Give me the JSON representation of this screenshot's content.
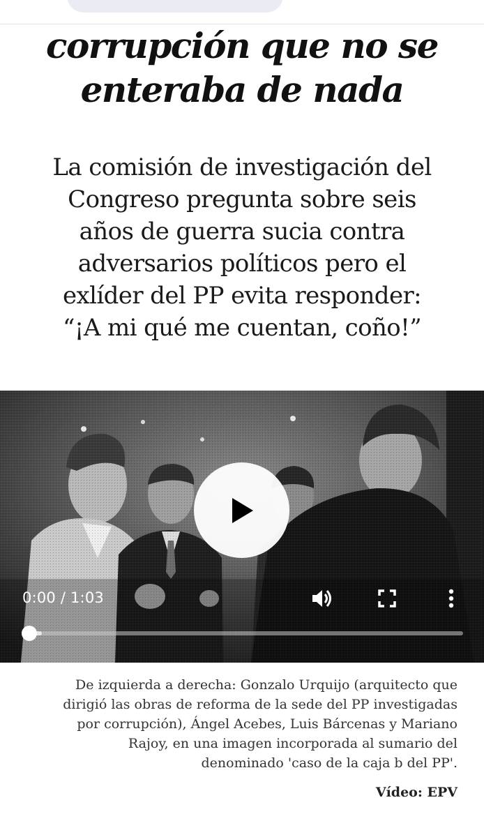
{
  "article": {
    "headline": "corrupción que no se\nenteraba de nada",
    "subtitle": "La comisión de investigación del\nCongreso pregunta sobre seis\naños de guerra sucia contra\nadversarios políticos pero el\nexlíder del PP evita responder:\n“¡A mi qué me cuentan, coño!”"
  },
  "video": {
    "current_time": "0:00",
    "duration": "1:03",
    "time_separator": " / ",
    "progress_fraction": 0.0,
    "icons": {
      "play": "play-icon",
      "volume": "volume-icon",
      "fullscreen": "fullscreen-icon",
      "more": "more-options-icon"
    }
  },
  "caption": {
    "text": "De izquierda a derecha: Gonzalo Urquijo (arquitecto que\ndirigió las obras de reforma de la sede del PP investigadas\npor corrupción), Ángel Acebes, Luis Bárcenas y Mariano\nRajoy, en una imagen incorporada al sumario del\ndenominado 'caso de la caja b del PP'.",
    "credit": "Vídeo: EPV"
  },
  "colors": {
    "page_background": "#ffffff",
    "text": "#111111",
    "video_background": "#2a2a2a",
    "control_white": "#ffffff"
  }
}
